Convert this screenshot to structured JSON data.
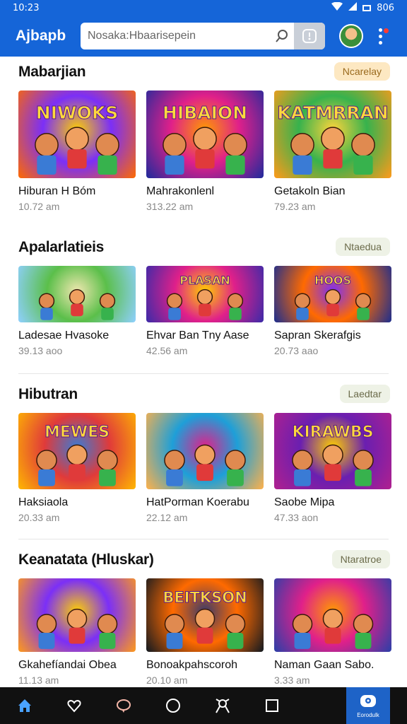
{
  "status": {
    "time": "10:23",
    "right": "806"
  },
  "app": {
    "logo": "Ajbapb",
    "search_placeholder": "Nosaka:Hbaarisepein"
  },
  "sections": [
    {
      "title": "Mabarjian",
      "action": "Ncarelay",
      "items": [
        {
          "title": "Hiburan H Bóm",
          "meta": "10.72 am",
          "art_text": "NIWOKS",
          "palette": [
            "#ff6a00",
            "#7b2ff7",
            "#ffd000"
          ]
        },
        {
          "title": "Mahrakonlenl",
          "meta": "313.22 am",
          "art_text": "HIBAION",
          "palette": [
            "#1e2a9c",
            "#e0208a",
            "#ff9a00"
          ]
        },
        {
          "title": "Getakoln Bian",
          "meta": "79.23 am",
          "art_text": "KATMRRAN",
          "palette": [
            "#ff9a1a",
            "#37b24d",
            "#ffd43b"
          ]
        }
      ]
    },
    {
      "title": "Apalarlatieis",
      "action": "Ntaedua",
      "items": [
        {
          "title": "Ladesae Hvasoke",
          "meta": "39.13 aoo",
          "art_text": "",
          "palette": [
            "#8fd0ff",
            "#5bbf4a",
            "#f0e7b0"
          ]
        },
        {
          "title": "Ehvar Ban Tny Aase",
          "meta": "42.56 am",
          "art_text": "PLASAN",
          "palette": [
            "#3b2aa8",
            "#e0208a",
            "#ffd000"
          ]
        },
        {
          "title": "Sapran Skerafgis",
          "meta": "20.73 aao",
          "art_text": "HOOS",
          "palette": [
            "#1b2d8f",
            "#ff6a00",
            "#7b2ff7"
          ]
        }
      ]
    },
    {
      "title": "Hibutran",
      "action": "Laedtar",
      "items": [
        {
          "title": "Haksiaola",
          "meta": "20.33 am",
          "art_text": "MEWES",
          "palette": [
            "#ffb700",
            "#e03a3a",
            "#3a7bd5"
          ]
        },
        {
          "title": "HatPorman Koerabu",
          "meta": "22.12 am",
          "art_text": "",
          "palette": [
            "#ffb14a",
            "#1e9fd8",
            "#e0208a"
          ]
        },
        {
          "title": "Saobe Mipa",
          "meta": "47.33 aon",
          "art_text": "KIRAWBS",
          "palette": [
            "#b0208f",
            "#6a1fb0",
            "#ffd000"
          ]
        }
      ]
    },
    {
      "title": "Keanatata (Hluskar)",
      "action": "Ntaratroe",
      "items": [
        {
          "title": "Gkahefíandai Obea",
          "meta": "11.13 am",
          "art_text": "",
          "palette": [
            "#ff9a1a",
            "#7b2ff7",
            "#ffd000"
          ]
        },
        {
          "title": "Bonoakpahscoroh",
          "meta": "20.10 am",
          "art_text": "BEITKSON",
          "palette": [
            "#101820",
            "#ff6a00",
            "#3a3a6a"
          ]
        },
        {
          "title": "Naman Gaan Sabo.",
          "meta": "3.33 am",
          "art_text": "",
          "palette": [
            "#2a3fa8",
            "#e0208a",
            "#ff9a00"
          ]
        }
      ]
    }
  ],
  "bottom_nav": [
    {
      "icon": "home-icon",
      "color": "#4aa3ff"
    },
    {
      "icon": "heart-icon",
      "color": "#ffffff"
    },
    {
      "icon": "chat-icon",
      "color": "#f4b6a8"
    },
    {
      "icon": "circle-icon",
      "color": "#ffffff"
    },
    {
      "icon": "person-icon",
      "color": "#ffffff"
    },
    {
      "icon": "square-icon",
      "color": "#ffffff"
    }
  ],
  "bottom_nav_active": {
    "icon": "chat-bubble-icon",
    "label": "Eorodulk"
  }
}
